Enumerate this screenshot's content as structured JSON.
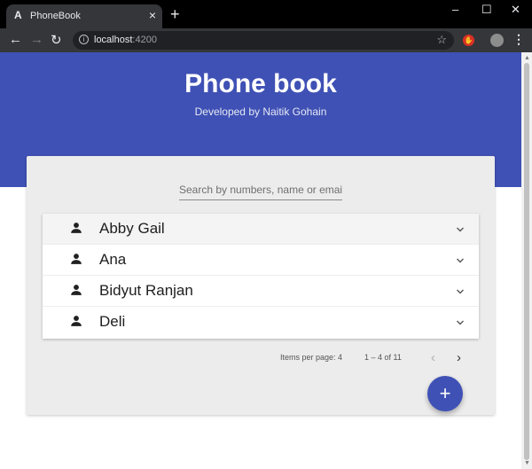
{
  "browser": {
    "tab_title": "PhoneBook",
    "tab_favicon": "A",
    "new_tab": "+",
    "url_host": "localhost",
    "url_port": ":4200",
    "window_controls": {
      "minimize": "–",
      "maximize": "☐",
      "close": "✕"
    }
  },
  "header": {
    "title": "Phone book",
    "subtitle": "Developed by Naitik Gohain",
    "color": "#3f51b5"
  },
  "search": {
    "placeholder": "Search by numbers, name or email",
    "value": ""
  },
  "contacts": [
    {
      "name": "Abby Gail"
    },
    {
      "name": "Ana"
    },
    {
      "name": "Bidyut Ranjan"
    },
    {
      "name": "Deli"
    }
  ],
  "paginator": {
    "items_per_page_label": "Items per page: 4",
    "range_label": "1 – 4 of 11",
    "prev": "‹",
    "next": "›"
  },
  "fab": {
    "label": "+"
  },
  "icons": {
    "contact": "person-icon",
    "expand": "chevron-down-icon",
    "add": "add-icon"
  }
}
